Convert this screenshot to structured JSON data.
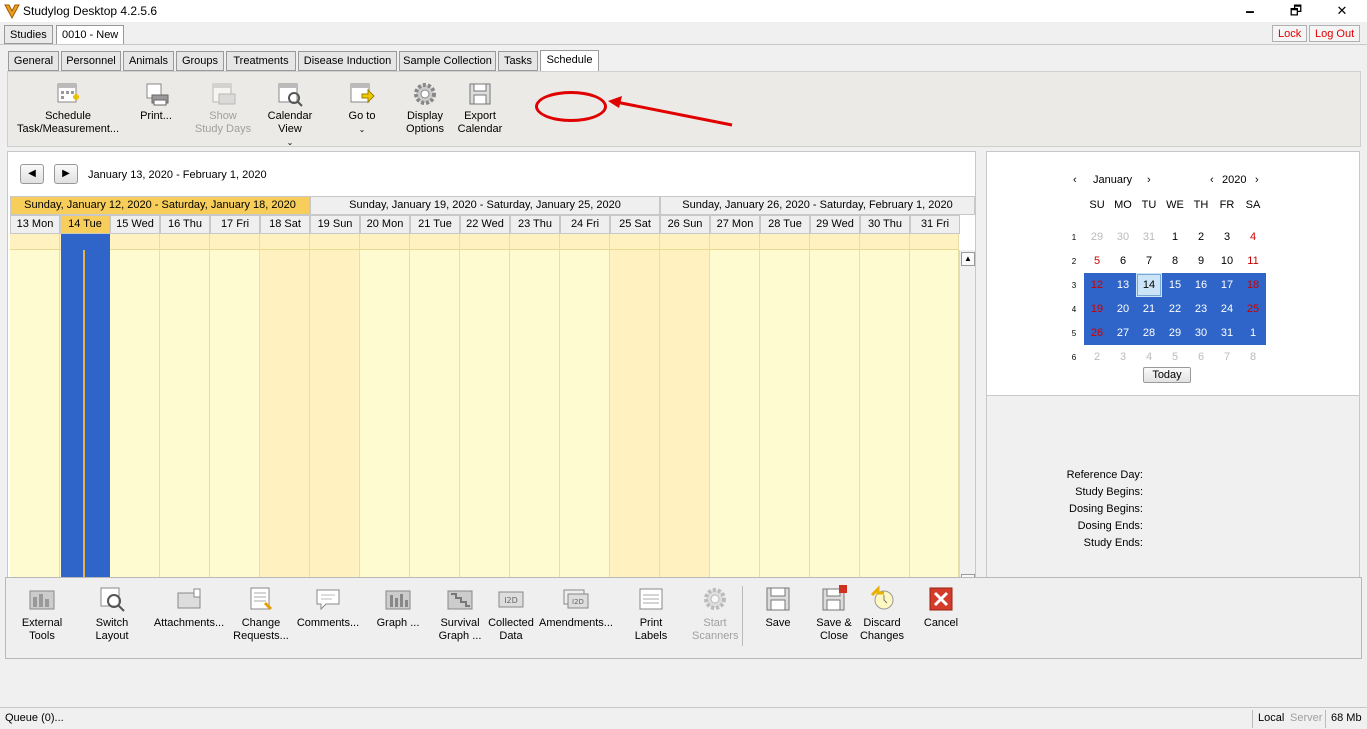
{
  "window": {
    "title": "Studylog Desktop 4.2.5.6",
    "minimize": "🗕",
    "restore": "🗗",
    "close": "✕"
  },
  "top_tabs": [
    "Studies",
    "0010 - New"
  ],
  "top_buttons": {
    "lock": "Lock",
    "logout": "Log Out"
  },
  "tabs": [
    "General",
    "Personnel",
    "Animals",
    "Groups",
    "Treatments",
    "Disease Induction",
    "Sample Collection",
    "Tasks",
    "Schedule"
  ],
  "active_tab": "Schedule",
  "toolbar": {
    "schedule": "Schedule Task/Measurement...",
    "print": "Print...",
    "show_study_days": "Show Study Days",
    "calendar_view": "Calendar View",
    "go_to": "Go to",
    "display_options": "Display Options",
    "export_calendar": "Export Calendar"
  },
  "calendar": {
    "range": "January 13, 2020 - February 1, 2020",
    "prev": "◀",
    "next": "▶",
    "weeks": [
      "Sunday, January 12, 2020 - Saturday, January 18, 2020",
      "Sunday, January 19, 2020 - Saturday, January 25, 2020",
      "Sunday, January 26, 2020 - Saturday, February 1, 2020"
    ],
    "days": [
      "13 Mon",
      "14 Tue",
      "15 Wed",
      "16 Thu",
      "17 Fri",
      "18 Sat",
      "19 Sun",
      "20 Mon",
      "21 Tue",
      "22 Wed",
      "23 Thu",
      "24 Fri",
      "25 Sat",
      "26 Sun",
      "27 Mon",
      "28 Tue",
      "29 Wed",
      "30 Thu",
      "31 Fri"
    ],
    "today_index": 1
  },
  "minical": {
    "month": "January",
    "year": "2020",
    "prev": "‹",
    "next": "›",
    "dow": [
      "SU",
      "MO",
      "TU",
      "WE",
      "TH",
      "FR",
      "SA"
    ],
    "week_numbers": [
      "1",
      "2",
      "3",
      "4",
      "5",
      "6"
    ],
    "rows": [
      [
        "29",
        "30",
        "31",
        "1",
        "2",
        "3",
        "4"
      ],
      [
        "5",
        "6",
        "7",
        "8",
        "9",
        "10",
        "11"
      ],
      [
        "12",
        "13",
        "14",
        "15",
        "16",
        "17",
        "18"
      ],
      [
        "19",
        "20",
        "21",
        "22",
        "23",
        "24",
        "25"
      ],
      [
        "26",
        "27",
        "28",
        "29",
        "30",
        "31",
        "1"
      ],
      [
        "2",
        "3",
        "4",
        "5",
        "6",
        "7",
        "8"
      ]
    ],
    "today_label": "Today"
  },
  "reference": {
    "reference_day": "Reference Day:",
    "study_begins": "Study Begins:",
    "dosing_begins": "Dosing Begins:",
    "dosing_ends": "Dosing Ends:",
    "study_ends": "Study Ends:"
  },
  "bottom_toolbar": {
    "external_tools": "External Tools",
    "switch_layout": "Switch Layout",
    "attachments": "Attachments...",
    "change_requests": "Change Requests...",
    "comments": "Comments...",
    "graph": "Graph ...",
    "survival_graph": "Survival Graph ...",
    "collected_data": "Collected Data",
    "amendments": "Amendments...",
    "print_labels": "Print Labels",
    "start_scanners": "Start Scanners",
    "save": "Save",
    "save_close": "Save & Close",
    "discard_changes": "Discard Changes",
    "cancel": "Cancel"
  },
  "status": {
    "queue": "Queue (0)...",
    "local": "Local",
    "server": "Server",
    "memory": "68 Mb"
  },
  "colors": {
    "accent": "#2f65c8",
    "current_week": "#f7ce5c",
    "day_bg": "#fffbd0",
    "annotation": "#e00000"
  }
}
